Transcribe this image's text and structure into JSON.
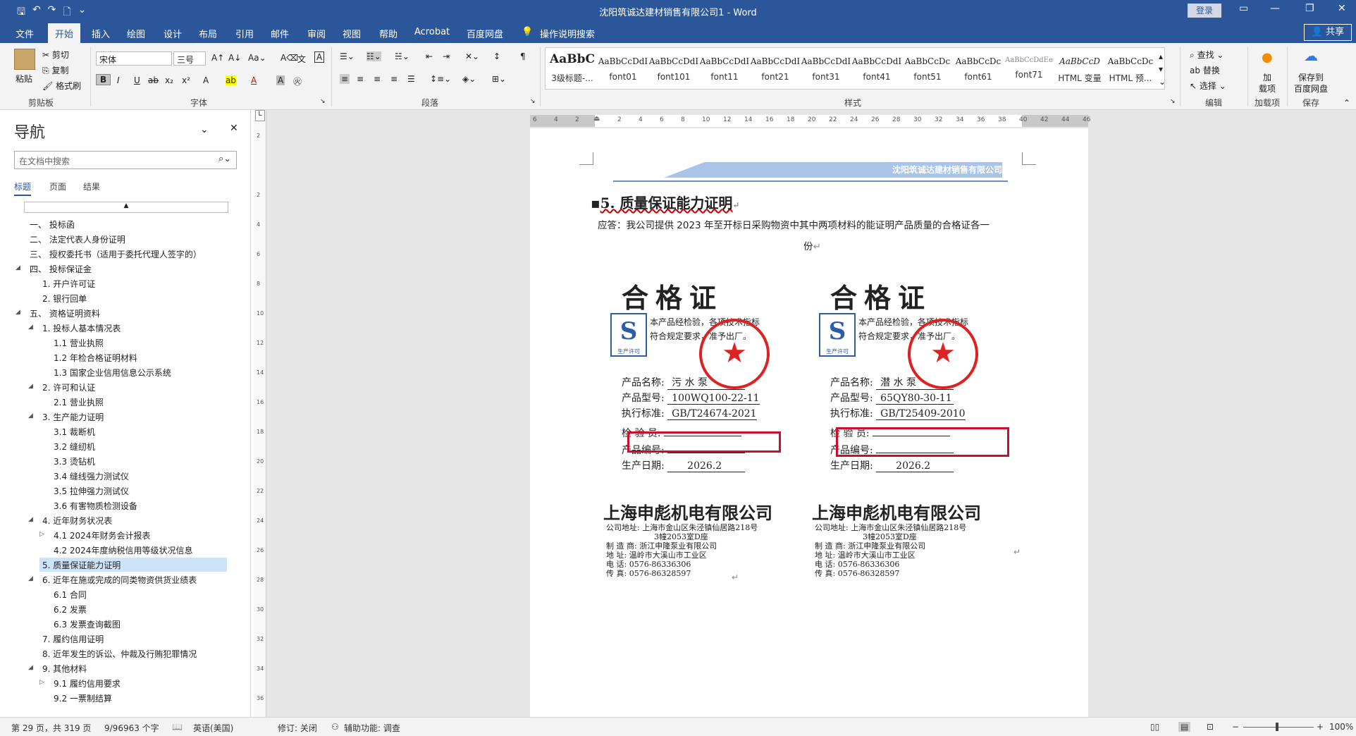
{
  "window": {
    "title": "沈阳筑诚达建材销售有限公司1 - Word",
    "login": "登录",
    "share": "共享"
  },
  "ribbon_tabs": [
    "文件",
    "开始",
    "插入",
    "绘图",
    "设计",
    "布局",
    "引用",
    "邮件",
    "审阅",
    "视图",
    "帮助",
    "Acrobat",
    "百度网盘",
    "操作说明搜索"
  ],
  "active_tab": "开始",
  "clipboard": {
    "paste": "粘贴",
    "cut": "剪切",
    "copy": "复制",
    "format_painter": "格式刷",
    "group": "剪贴板"
  },
  "font": {
    "name": "宋体",
    "size": "三号",
    "group": "字体"
  },
  "paragraph": {
    "group": "段落"
  },
  "styles": {
    "group": "样式",
    "items": [
      {
        "preview": "AaBbC",
        "name": "3级标题-..."
      },
      {
        "preview": "AaBbCcDdI",
        "name": "font01"
      },
      {
        "preview": "AaBbCcDdI",
        "name": "font101"
      },
      {
        "preview": "AaBbCcDdI",
        "name": "font11"
      },
      {
        "preview": "AaBbCcDdI",
        "name": "font21"
      },
      {
        "preview": "AaBbCcDdI",
        "name": "font31"
      },
      {
        "preview": "AaBbCcDdI",
        "name": "font41"
      },
      {
        "preview": "AaBbCcDc",
        "name": "font51"
      },
      {
        "preview": "AaBbCcDc",
        "name": "font61"
      },
      {
        "preview": "AaBbCcDdEe",
        "name": "font71"
      },
      {
        "preview": "AaBbCcD",
        "name": "HTML 变量"
      },
      {
        "preview": "AaBbCcDc",
        "name": "HTML 预..."
      }
    ]
  },
  "editing": {
    "find": "查找",
    "replace": "替换",
    "select": "选择",
    "group": "编辑"
  },
  "addins": {
    "label1": "加",
    "label2": "载项",
    "group": "加载项"
  },
  "save_to": {
    "label1": "保存到",
    "label2": "百度网盘",
    "group": "保存"
  },
  "nav": {
    "title": "导航",
    "search_placeholder": "在文档中搜索",
    "tabs": [
      "标题",
      "页面",
      "结果"
    ],
    "items": [
      {
        "text": "一、 投标函",
        "level": 0,
        "tw": ""
      },
      {
        "text": "二、 法定代表人身份证明",
        "level": 0,
        "tw": ""
      },
      {
        "text": "三、 授权委托书（适用于委托代理人签字的）",
        "level": 0,
        "tw": ""
      },
      {
        "text": "四、 投标保证金",
        "level": 0,
        "tw": "open"
      },
      {
        "text": "1. 开户许可证",
        "level": 1,
        "tw": ""
      },
      {
        "text": "2. 银行回单",
        "level": 1,
        "tw": ""
      },
      {
        "text": "五、 资格证明资料",
        "level": 0,
        "tw": "open"
      },
      {
        "text": "1. 投标人基本情况表",
        "level": 1,
        "tw": "open"
      },
      {
        "text": "1.1 营业执照",
        "level": 2,
        "tw": ""
      },
      {
        "text": "1.2 年检合格证明材料",
        "level": 2,
        "tw": ""
      },
      {
        "text": "1.3 国家企业信用信息公示系统",
        "level": 2,
        "tw": ""
      },
      {
        "text": "2. 许可和认证",
        "level": 1,
        "tw": "open"
      },
      {
        "text": "2.1 营业执照",
        "level": 2,
        "tw": ""
      },
      {
        "text": "3. 生产能力证明",
        "level": 1,
        "tw": "open"
      },
      {
        "text": "3.1 裁断机",
        "level": 2,
        "tw": ""
      },
      {
        "text": "3.2 缝纫机",
        "level": 2,
        "tw": ""
      },
      {
        "text": "3.3 烫钻机",
        "level": 2,
        "tw": ""
      },
      {
        "text": "3.4 缝线强力测试仪",
        "level": 2,
        "tw": ""
      },
      {
        "text": "3.5 拉伸强力测试仪",
        "level": 2,
        "tw": ""
      },
      {
        "text": "3.6 有害物质检测设备",
        "level": 2,
        "tw": ""
      },
      {
        "text": "4. 近年财务状况表",
        "level": 1,
        "tw": "open"
      },
      {
        "text": "4.1 2024年财务会计报表",
        "level": 2,
        "tw": "closed"
      },
      {
        "text": "4.2 2024年度纳税信用等级状况信息",
        "level": 2,
        "tw": ""
      },
      {
        "text": "5. 质量保证能力证明",
        "level": 1,
        "tw": "",
        "selected": true
      },
      {
        "text": "6. 近年在施或完成的同类物资供货业绩表",
        "level": 1,
        "tw": "open"
      },
      {
        "text": "6.1 合同",
        "level": 2,
        "tw": ""
      },
      {
        "text": "6.2 发票",
        "level": 2,
        "tw": ""
      },
      {
        "text": "6.3 发票查询截图",
        "level": 2,
        "tw": ""
      },
      {
        "text": "7. 履约信用证明",
        "level": 1,
        "tw": ""
      },
      {
        "text": "8. 近年发生的诉讼、仲裁及行贿犯罪情况",
        "level": 1,
        "tw": ""
      },
      {
        "text": "9. 其他材料",
        "level": 1,
        "tw": "open"
      },
      {
        "text": "9.1 履约信用要求",
        "level": 2,
        "tw": "closed"
      },
      {
        "text": "9.2 一票制结算",
        "level": 2,
        "tw": ""
      }
    ]
  },
  "ruler_ticks": [
    "6",
    "4",
    "2",
    "",
    "2",
    "4",
    "6",
    "8",
    "10",
    "12",
    "14",
    "16",
    "18",
    "20",
    "22",
    "24",
    "26",
    "28",
    "30",
    "32",
    "34",
    "36",
    "38",
    "40",
    "42",
    "44",
    "46"
  ],
  "vruler_ticks": [
    "2",
    "",
    "2",
    "4",
    "6",
    "8",
    "10",
    "12",
    "14",
    "16",
    "18",
    "20",
    "22",
    "24",
    "26",
    "28",
    "30",
    "32",
    "34",
    "36"
  ],
  "doc": {
    "header_company": "沈阳筑诚达建材销售有限公司",
    "heading": "5. 质量保证能力证明",
    "body_line1": "应答：我公司提供 2023 年至开标日采购物资中其中两项材料的能证明产品质量的合格证各一",
    "body_line2": "份"
  },
  "certs": [
    {
      "title": "合格证",
      "note1": "本产品经检验，各项技术指标",
      "note2": "符合规定要求，准予出厂。",
      "logo_caption": "生产许可",
      "seal_char": "★",
      "product_name_label": "产品名称:",
      "product_name": "污 水 泵",
      "model_label": "产品型号:",
      "model": "100WQ100-22-11",
      "standard_label": "执行标准:",
      "standard": "GB/T24674-2021",
      "inspector_label": "检 验 员:",
      "serial_label": "产品编号:",
      "date_label": "生产日期:",
      "date": "2026.2",
      "company": "上海申彪机电有限公司",
      "addr1": "公司地址: 上海市金山区朱泾镇仙居路218号",
      "addr2": "3幢2053室D座",
      "addr3": "制 造 商: 浙江申隆泵业有限公司",
      "addr4": "地    址: 温岭市大溪山市工业区",
      "addr5": "电    话: 0576-86336306",
      "addr6": "传    真: 0576-86328597"
    },
    {
      "title": "合格证",
      "note1": "本产品经检验，各项技术指标",
      "note2": "符合规定要求，准予出厂。",
      "logo_caption": "生产许可",
      "seal_char": "★",
      "product_name_label": "产品名称:",
      "product_name": "潜 水 泵",
      "model_label": "产品型号:",
      "model": "65QY80-30-11",
      "standard_label": "执行标准:",
      "standard": "GB/T25409-2010",
      "inspector_label": "检 验 员:",
      "serial_label": "产品编号:",
      "date_label": "生产日期:",
      "date": "2026.2",
      "company": "上海申彪机电有限公司",
      "addr1": "公司地址: 上海市金山区朱泾镇仙居路218号",
      "addr2": "3幢2053室D座",
      "addr3": "制 造 商: 浙江申隆泵业有限公司",
      "addr4": "地    址: 温岭市大溪山市工业区",
      "addr5": "电    话: 0576-86336306",
      "addr6": "传    真: 0576-86328597"
    }
  ],
  "status": {
    "page": "第 29 页，共 319 页",
    "words": "9/96963 个字",
    "lang": "英语(美国)",
    "track": "修订: 关闭",
    "access": "辅助功能: 调查",
    "zoom": "100%"
  },
  "colors": {
    "brand": "#2b579a",
    "highlight": "#c8102e"
  }
}
